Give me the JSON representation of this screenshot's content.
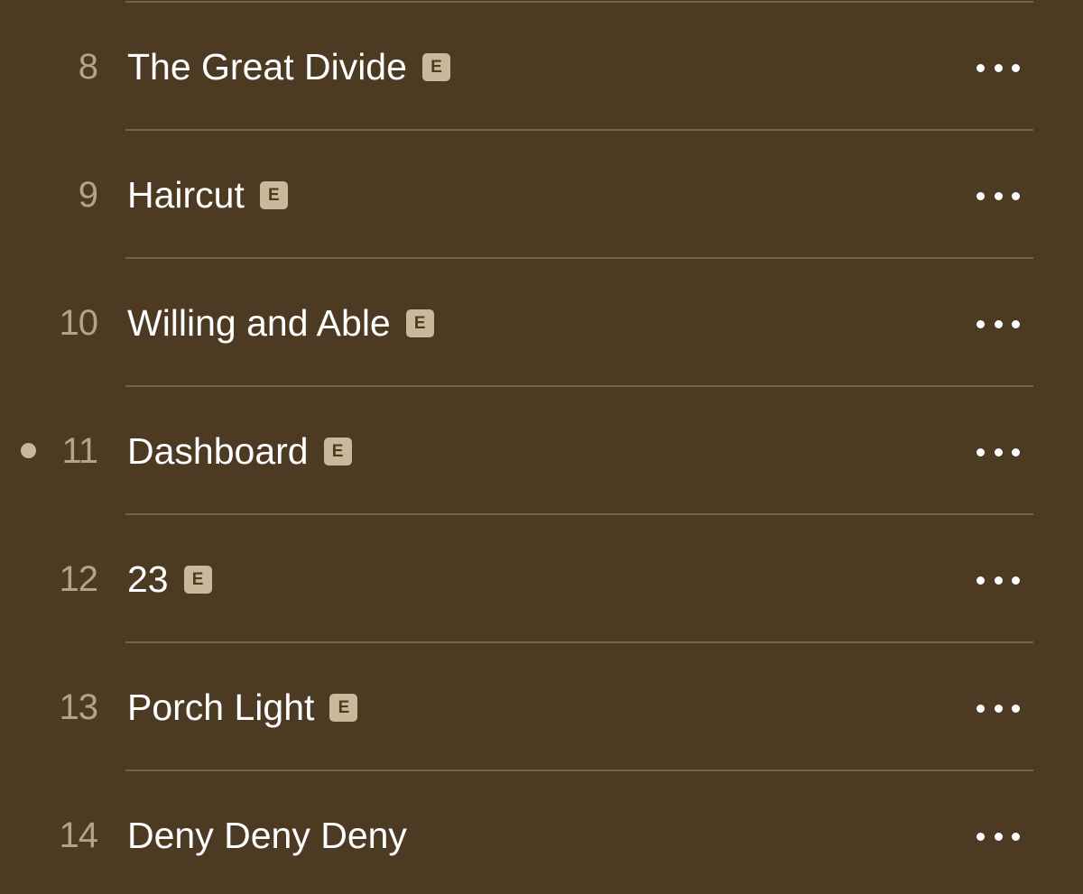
{
  "tracks": [
    {
      "number": "8",
      "title": "The Great Divide",
      "explicit": true,
      "explicit_label": "E",
      "playing": false
    },
    {
      "number": "9",
      "title": "Haircut",
      "explicit": true,
      "explicit_label": "E",
      "playing": false
    },
    {
      "number": "10",
      "title": "Willing and Able",
      "explicit": true,
      "explicit_label": "E",
      "playing": false
    },
    {
      "number": "11",
      "title": "Dashboard",
      "explicit": true,
      "explicit_label": "E",
      "playing": true
    },
    {
      "number": "12",
      "title": "23",
      "explicit": true,
      "explicit_label": "E",
      "playing": false
    },
    {
      "number": "13",
      "title": "Porch Light",
      "explicit": true,
      "explicit_label": "E",
      "playing": false
    },
    {
      "number": "14",
      "title": "Deny Deny Deny",
      "explicit": false,
      "explicit_label": "",
      "playing": false
    }
  ],
  "icons": {
    "more": "ellipsis-icon",
    "now_playing": "now-playing-dot-icon"
  },
  "colors": {
    "background": "#4d3a23",
    "divider": "#75634b",
    "number": "#b4a387",
    "title": "#ffffff",
    "badge": "#c9b89a"
  }
}
